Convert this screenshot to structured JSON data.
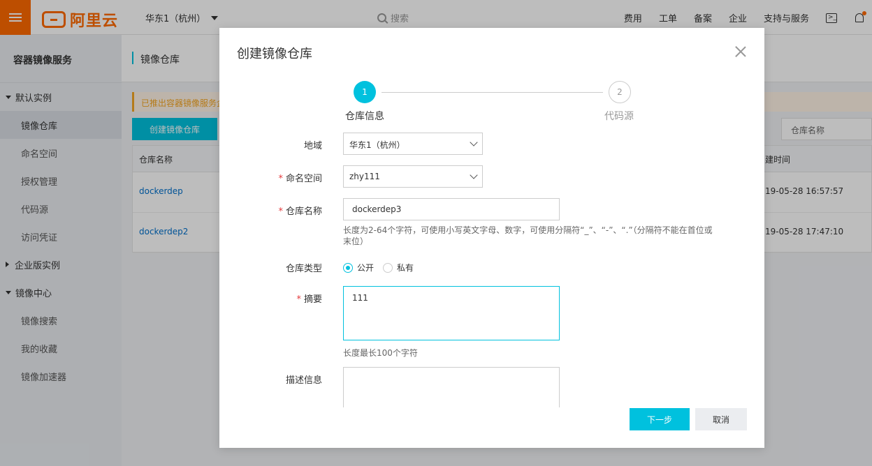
{
  "topbar": {
    "logo_text": "阿里云",
    "region": "华东1（杭州）",
    "search_placeholder": "搜索",
    "links": [
      "费用",
      "工单",
      "备案",
      "企业",
      "支持与服务"
    ],
    "terminal_icon": "terminal-icon",
    "bell_icon": "bell-icon"
  },
  "sidebar": {
    "title": "容器镜像服务",
    "groups": [
      {
        "label": "默认实例",
        "expanded": true,
        "items": [
          "镜像仓库",
          "命名空间",
          "授权管理",
          "代码源",
          "访问凭证"
        ]
      },
      {
        "label": "企业版实例",
        "expanded": false,
        "items": []
      },
      {
        "label": "镜像中心",
        "expanded": true,
        "items": [
          "镜像搜索",
          "我的收藏",
          "镜像加速器"
        ]
      }
    ],
    "active_item": "镜像仓库"
  },
  "page": {
    "title": "镜像仓库",
    "notice": "已推出容器镜像服务企",
    "create_button": "创建镜像仓库",
    "search_placeholder": "仓库名称",
    "table": {
      "columns": [
        "仓库名称",
        "建时间"
      ],
      "rows": [
        {
          "name": "dockerdep",
          "time": "19-05-28 16:57:57"
        },
        {
          "name": "dockerdep2",
          "time": "19-05-28 17:47:10"
        }
      ]
    }
  },
  "modal": {
    "title": "创建镜像仓库",
    "steps": [
      {
        "number": "1",
        "label": "仓库信息",
        "active": true
      },
      {
        "number": "2",
        "label": "代码源",
        "active": false
      }
    ],
    "form": {
      "region_label": "地域",
      "region_value": "华东1（杭州）",
      "namespace_label": "命名空间",
      "namespace_value": "zhy111",
      "repo_name_label": "仓库名称",
      "repo_name_value": "dockerdep3",
      "repo_name_help": "长度为2-64个字符，可使用小写英文字母、数字，可使用分隔符“_”、“-”、“.”（分隔符不能在首位或末位）",
      "repo_type_label": "仓库类型",
      "repo_type_options": [
        {
          "label": "公开",
          "checked": true
        },
        {
          "label": "私有",
          "checked": false
        }
      ],
      "summary_label": "摘要",
      "summary_value": "111",
      "summary_help": "长度最长100个字符",
      "description_label": "描述信息",
      "description_value": ""
    },
    "next_button": "下一步",
    "cancel_button": "取消"
  },
  "colors": {
    "brand": "#ff6a00",
    "accent": "#00c1de",
    "required": "#e4393c",
    "link": "#0070cc"
  }
}
